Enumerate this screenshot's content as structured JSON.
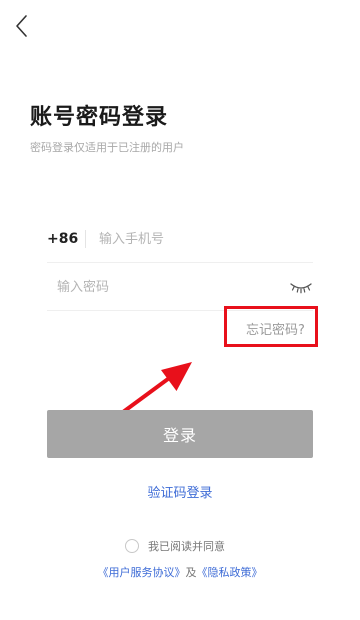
{
  "header": {
    "back_icon": "back-arrow-icon"
  },
  "page": {
    "title": "账号密码登录",
    "subtitle": "密码登录仅适用于已注册的用户"
  },
  "form": {
    "country_code": "+86",
    "phone_placeholder": "输入手机号",
    "phone_value": "",
    "password_placeholder": "输入密码",
    "password_value": "",
    "eye_icon": "eye-closed-icon",
    "forgot_label": "忘记密码?",
    "login_label": "登录",
    "sms_login_label": "验证码登录"
  },
  "agreement": {
    "agree_text": "我已阅读并同意",
    "terms_label": "《用户服务协议》",
    "and_text": "及",
    "privacy_label": "《隐私政策》",
    "checked": false
  },
  "annotation": {
    "highlight_color": "#e8101b",
    "arrow_color": "#e8101b"
  },
  "colors": {
    "link": "#3d6bd6",
    "button_disabled": "#a6a6a6"
  }
}
